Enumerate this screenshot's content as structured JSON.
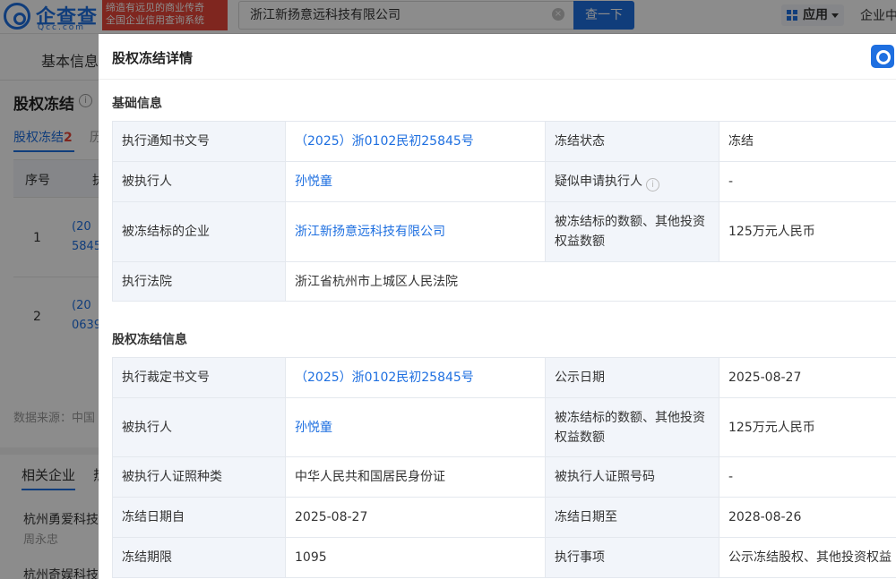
{
  "header": {
    "logo_text": "企查查",
    "logo_sub": "Qcc.com",
    "slogan_line1": "缔造有远见的商业传奇",
    "slogan_line2": "全国企业信用查询系统",
    "search_value": "浙江新扬意远科技有限公司",
    "search_button": "查一下",
    "apps_label": "应用",
    "right_text": "企业中"
  },
  "background": {
    "tab": "基本信息",
    "section_title": "股权冻结",
    "subtab_label": "股权冻结",
    "subtab_count": "2",
    "subtab2": "历",
    "table": {
      "col_no": "序号",
      "col_2": "执",
      "rows": [
        {
          "no": "1",
          "line1": "(20",
          "line2": "5845"
        },
        {
          "no": "2",
          "line1": "(20",
          "line2": "0639"
        }
      ]
    },
    "source": "数据来源：中国",
    "related_tab": "相关企业",
    "related_tab2": "热",
    "companies": [
      {
        "name": "杭州勇爱科技",
        "person": "周永忠"
      },
      {
        "name": "杭州奇娱科技",
        "person": ""
      }
    ]
  },
  "modal": {
    "title": "股权冻结详情",
    "basic_section": "基础信息",
    "basic_rows": [
      {
        "l1": "执行通知书文号",
        "v1": "（2025）浙0102民初25845号",
        "l2": "冻结状态",
        "v2": "冻结"
      },
      {
        "l1": "被执行人",
        "v1": "孙悦童",
        "l2": "疑似申请执行人",
        "v2": "-"
      },
      {
        "l1": "被冻结标的企业",
        "v1": "浙江新扬意远科技有限公司",
        "l2": "被冻结标的数额、其他投资权益数额",
        "v2": "125万元人民币"
      },
      {
        "l1": "执行法院",
        "v1": "浙江省杭州市上城区人民法院"
      }
    ],
    "freeze_section": "股权冻结信息",
    "freeze_rows": [
      {
        "l1": "执行裁定书文号",
        "v1": "（2025）浙0102民初25845号",
        "l2": "公示日期",
        "v2": "2025-08-27"
      },
      {
        "l1": "被执行人",
        "v1": "孙悦童",
        "l2": "被冻结标的数额、其他投资权益数额",
        "v2": "125万元人民币"
      },
      {
        "l1": "被执行人证照种类",
        "v1": "中华人民共和国居民身份证",
        "l2": "被执行人证照号码",
        "v2": "-"
      },
      {
        "l1": "冻结日期自",
        "v1": "2025-08-27",
        "l2": "冻结日期至",
        "v2": "2028-08-26"
      },
      {
        "l1": "冻结期限",
        "v1": "1095",
        "l2": "执行事项",
        "v2": "公示冻结股权、其他投资权益"
      }
    ]
  },
  "colors": {
    "accent": "#1e6fe0",
    "label_bg": "#f2f5fa",
    "slogan_bg": "#e8463a"
  }
}
